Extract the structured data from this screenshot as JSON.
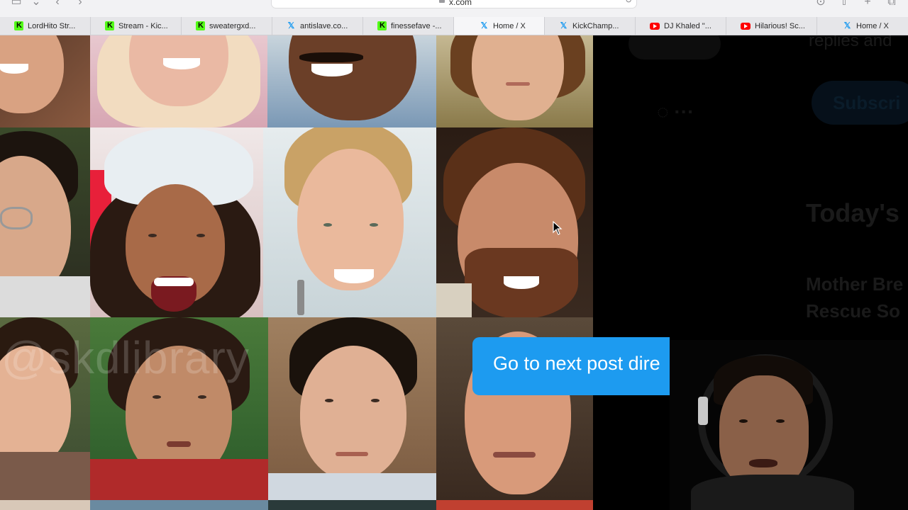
{
  "browser": {
    "url": "x.com",
    "tabs": [
      {
        "label": "LordHito Str...",
        "favicon": "kick-icon",
        "active": false
      },
      {
        "label": "Stream - Kic...",
        "favicon": "kick-icon",
        "active": false
      },
      {
        "label": "sweatergxd...",
        "favicon": "kick-icon",
        "active": false
      },
      {
        "label": "antislave.co...",
        "favicon": "x-icon",
        "active": false
      },
      {
        "label": "finessefave -...",
        "favicon": "kick-icon",
        "active": false
      },
      {
        "label": "Home / X",
        "favicon": "x-icon",
        "active": true
      },
      {
        "label": "KickChamp...",
        "favicon": "x-icon",
        "active": false
      },
      {
        "label": "DJ Khaled \"...",
        "favicon": "youtube-icon",
        "active": false
      },
      {
        "label": "Hilarious! Sc...",
        "favicon": "youtube-icon",
        "active": false
      },
      {
        "label": "Home / X",
        "favicon": "x-icon",
        "active": false
      }
    ]
  },
  "watermark": "@skdlibrary",
  "tooltip": {
    "text": "Go to next post dire"
  },
  "right_panel": {
    "text1": "replies and",
    "button": "Subscri",
    "heading": "Today's",
    "news1": "Mother Bre",
    "news2": "Rescue So"
  },
  "colors": {
    "accent": "#1d9bf0",
    "kick": "#53fc18",
    "youtube": "#ff0000"
  }
}
